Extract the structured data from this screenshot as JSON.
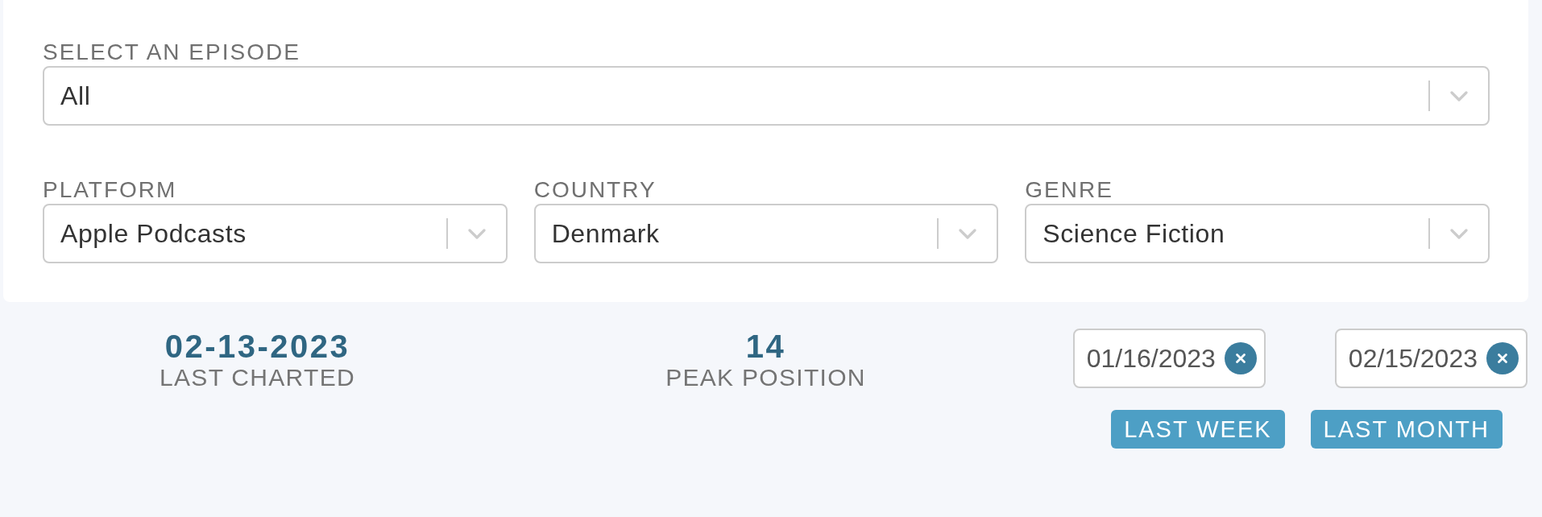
{
  "filters": {
    "episode": {
      "label": "SELECT AN EPISODE",
      "value": "All"
    },
    "selects": [
      {
        "label": "PLATFORM",
        "value": "Apple Podcasts"
      },
      {
        "label": "COUNTRY",
        "value": "Denmark"
      },
      {
        "label": "GENRE",
        "value": "Science Fiction"
      }
    ]
  },
  "stats": [
    {
      "value": "02-13-2023",
      "label": "LAST CHARTED"
    },
    {
      "value": "14",
      "label": "PEAK POSITION"
    }
  ],
  "date_range": {
    "start": "01/16/2023",
    "end": "02/15/2023"
  },
  "quick_ranges": [
    "LAST WEEK",
    "LAST MONTH"
  ]
}
